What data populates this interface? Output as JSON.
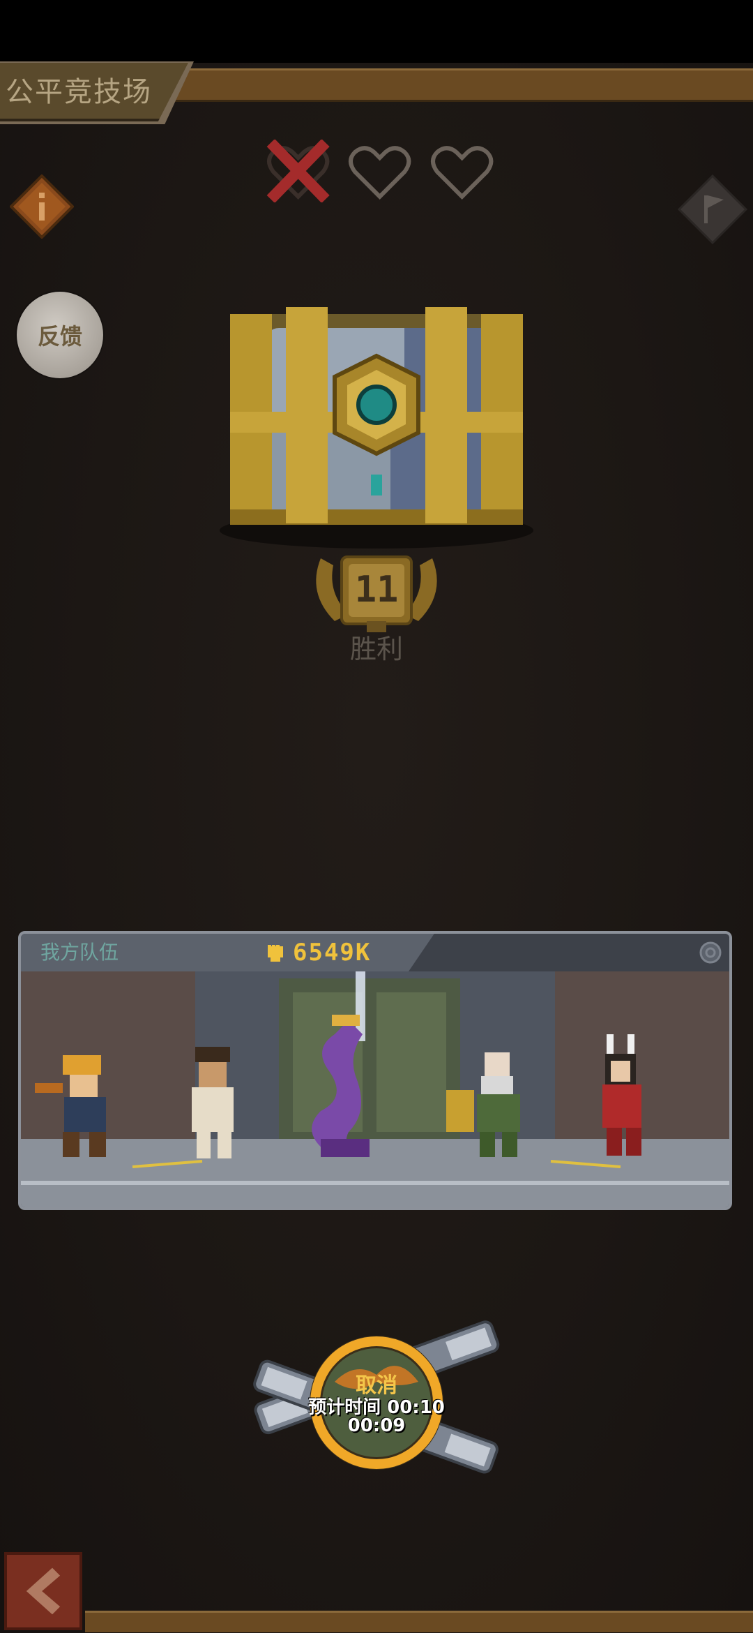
{
  "header": {
    "title": "公平竞技场"
  },
  "lives": {
    "total": 3,
    "lost": 1,
    "icons": [
      "x-mark-icon",
      "heart-outline-icon",
      "heart-outline-icon"
    ]
  },
  "buttons": {
    "info_icon": "info-icon",
    "flag_icon": "flag-icon",
    "feedback_label": "反馈",
    "back_icon": "back-arrow-icon"
  },
  "reward": {
    "wins": "11",
    "wins_label": "胜利"
  },
  "team": {
    "label": "我方队伍",
    "power": "6549K",
    "heroes": [
      "hero-1",
      "hero-2",
      "hero-3",
      "hero-4",
      "hero-5"
    ]
  },
  "matchmaking": {
    "cancel_label": "取消",
    "eta_label": "预计时间 00:10",
    "elapsed": "00:09"
  },
  "colors": {
    "background": "#1a1614",
    "accent_gold": "#f0c23c",
    "team_label": "#6fa6a0",
    "lost_life": "#a42b2b",
    "back_button": "#7a2f20"
  }
}
